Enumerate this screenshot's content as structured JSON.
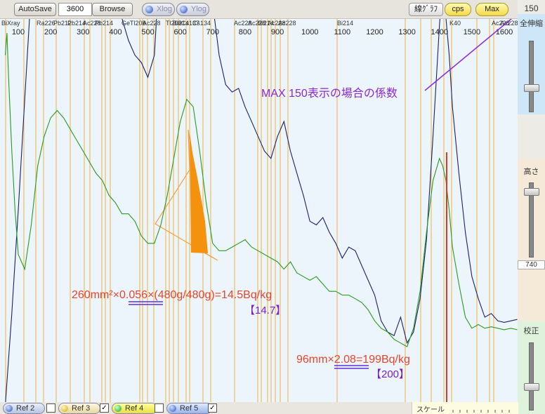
{
  "toolbar": {
    "autosave_label": "AutoSave",
    "count_value": "3600",
    "browse_label": "Browse",
    "xlog_label": "Xlog",
    "ylog_label": "Ylog",
    "line_graph_label": "線ｸﾞﾗﾌ",
    "cps_label": "cps",
    "max_label": "Max",
    "max_value": "150"
  },
  "side": {
    "zoom_label": "全伸縮",
    "height_label": "高さ",
    "height_value": "740",
    "calib_label": "校正"
  },
  "bottom": {
    "refs": [
      {
        "label": "Ref 2",
        "checked": false
      },
      {
        "label": "Ref 3",
        "checked": true
      },
      {
        "label": "Ref 4",
        "checked": false
      },
      {
        "label": "Ref 5",
        "checked": true
      }
    ],
    "scale_label": "スケール"
  },
  "chart_data": {
    "type": "line",
    "x_ticks": [
      100,
      200,
      300,
      400,
      500,
      600,
      700,
      800,
      900,
      1000,
      1100,
      1200,
      1300,
      1400,
      1500,
      1600
    ],
    "nuclide_labels": [
      "BiXray",
      "Ra226",
      "Pb212",
      "Pb214",
      "Ac228",
      "Pb214",
      "Ge",
      "Tl208",
      "Ac228",
      "Tl208",
      "Bi214",
      "Cs137",
      "Cs134",
      "Ac228",
      "Ac228",
      "Bi214",
      "Ac228",
      "Ac228",
      "Bi214",
      "K40",
      "Ac228",
      "Ac228"
    ],
    "series": [
      {
        "color": "#1e1e6e",
        "x": [
          60,
          80,
          100,
          120,
          140,
          160,
          180,
          200,
          220,
          240,
          260,
          280,
          300,
          320,
          340,
          360,
          380,
          400,
          420,
          440,
          460,
          480,
          500,
          520,
          540,
          560,
          580,
          600,
          620,
          640,
          660,
          680,
          700,
          720,
          740,
          760,
          780,
          800,
          820,
          840,
          860,
          880,
          900,
          920,
          940,
          960,
          980,
          1000,
          1020,
          1040,
          1060,
          1080,
          1100,
          1120,
          1140,
          1160,
          1180,
          1200,
          1220,
          1240,
          1260,
          1280,
          1300,
          1320,
          1340,
          1360,
          1380,
          1400,
          1410,
          1420,
          1430,
          1440,
          1460,
          1480,
          1500,
          1520,
          1540,
          1560,
          1580,
          1600,
          1620,
          1640
        ],
        "y": [
          -5,
          120,
          260,
          410,
          560,
          700,
          820,
          900,
          930,
          950,
          960,
          960,
          960,
          955,
          945,
          900,
          780,
          620,
          520,
          490,
          470,
          460,
          440,
          470,
          620,
          720,
          790,
          880,
          920,
          890,
          760,
          640,
          540,
          470,
          430,
          420,
          425,
          400,
          380,
          360,
          340,
          330,
          360,
          380,
          340,
          310,
          280,
          245,
          240,
          250,
          230,
          215,
          195,
          210,
          205,
          185,
          165,
          145,
          110,
          95,
          90,
          115,
          80,
          95,
          140,
          220,
          360,
          510,
          570,
          520,
          470,
          400,
          310,
          230,
          170,
          140,
          115,
          120,
          110,
          108,
          110,
          112
        ]
      },
      {
        "color": "#2a9a20",
        "x": [
          60,
          65,
          70,
          80,
          90,
          100,
          120,
          140,
          160,
          180,
          200,
          220,
          240,
          260,
          280,
          300,
          320,
          340,
          360,
          380,
          400,
          420,
          440,
          460,
          480,
          500,
          520,
          540,
          560,
          580,
          600,
          620,
          640,
          660,
          680,
          700,
          720,
          740,
          760,
          780,
          800,
          820,
          840,
          860,
          880,
          900,
          920,
          940,
          960,
          980,
          1000,
          1020,
          1040,
          1060,
          1080,
          1100,
          1120,
          1140,
          1160,
          1180,
          1200,
          1220,
          1240,
          1260,
          1280,
          1300,
          1320,
          1340,
          1360,
          1380,
          1400,
          1410,
          1420,
          1430,
          1440,
          1460,
          1480,
          1500,
          1520,
          1540,
          1560,
          1580,
          1600,
          1620,
          1640
        ],
        "y": [
          470,
          500,
          440,
          340,
          260,
          200,
          180,
          240,
          320,
          360,
          385,
          395,
          385,
          370,
          355,
          340,
          325,
          310,
          300,
          280,
          270,
          255,
          255,
          245,
          225,
          215,
          215,
          240,
          280,
          330,
          380,
          410,
          400,
          340,
          270,
          215,
          205,
          205,
          210,
          215,
          220,
          210,
          205,
          200,
          195,
          190,
          180,
          190,
          175,
          170,
          165,
          170,
          160,
          150,
          150,
          145,
          145,
          140,
          135,
          125,
          110,
          100,
          95,
          85,
          80,
          75,
          100,
          150,
          230,
          300,
          330,
          320,
          300,
          260,
          210,
          160,
          115,
          100,
          105,
          100,
          102,
          100,
          98,
          100,
          98
        ]
      }
    ],
    "ylim": [
      0,
      500
    ],
    "xlim": [
      0,
      1650
    ]
  },
  "annotations": {
    "max_note": "MAX 150表示の場合の係数",
    "calc1": "260mm²×0.056×(480g/480g)=14.5Bq/kg",
    "calc1_bracket": "【14.7】",
    "calc2": "96mm×2.08=199Bq/kg",
    "calc2_bracket": "【200】"
  }
}
